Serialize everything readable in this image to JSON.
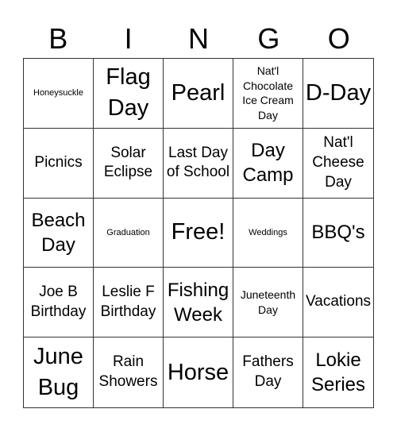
{
  "header": {
    "letters": [
      "B",
      "I",
      "N",
      "G",
      "O"
    ]
  },
  "cells": [
    {
      "text": "Honeysuckle",
      "size": "s-xs"
    },
    {
      "text": "Flag Day",
      "size": "s-xl"
    },
    {
      "text": "Pearl",
      "size": "s-xl"
    },
    {
      "text": "Nat'l Chocolate Ice Cream Day",
      "size": "s-sm"
    },
    {
      "text": "D-Day",
      "size": "s-xl"
    },
    {
      "text": "Picnics",
      "size": "s-md"
    },
    {
      "text": "Solar Eclipse",
      "size": "s-md"
    },
    {
      "text": "Last Day of School",
      "size": "s-md"
    },
    {
      "text": "Day Camp",
      "size": "s-lg"
    },
    {
      "text": "Nat'l Cheese Day",
      "size": "s-md"
    },
    {
      "text": "Beach Day",
      "size": "s-lg"
    },
    {
      "text": "Graduation",
      "size": "s-xs"
    },
    {
      "text": "Free!",
      "size": "s-xl"
    },
    {
      "text": "Weddings",
      "size": "s-xs"
    },
    {
      "text": "BBQ's",
      "size": "s-lg"
    },
    {
      "text": "Joe B Birthday",
      "size": "s-md"
    },
    {
      "text": "Leslie F Birthday",
      "size": "s-md"
    },
    {
      "text": "Fishing Week",
      "size": "s-lg"
    },
    {
      "text": "Juneteenth Day",
      "size": "s-sm"
    },
    {
      "text": "Vacations",
      "size": "s-md"
    },
    {
      "text": "June Bug",
      "size": "s-xl"
    },
    {
      "text": "Rain Showers",
      "size": "s-md"
    },
    {
      "text": "Horse",
      "size": "s-xl"
    },
    {
      "text": "Fathers Day",
      "size": "s-md"
    },
    {
      "text": "Lokie Series",
      "size": "s-lg"
    }
  ]
}
